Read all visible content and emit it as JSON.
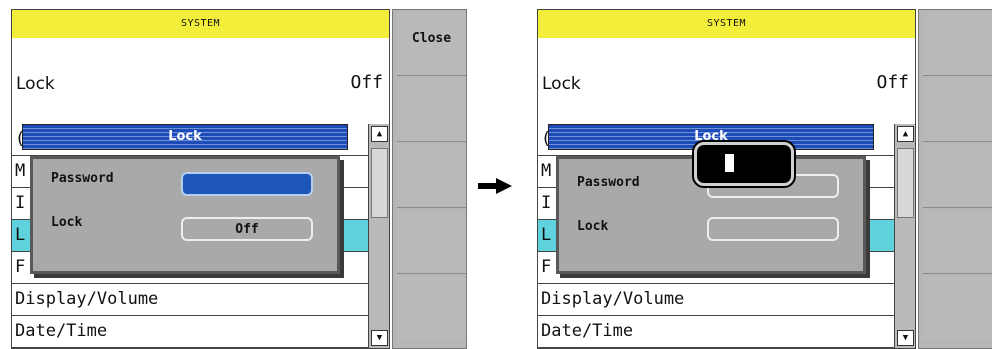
{
  "left_screen": {
    "header": "SYSTEM",
    "lock_label": "Lock",
    "lock_value": "Off",
    "list_items": [
      "(",
      "M",
      "I",
      "L",
      "F",
      "Display/Volume",
      "Date/Time"
    ],
    "side_buttons": [
      "Close",
      "",
      "",
      "",
      ""
    ],
    "dialog": {
      "title": "Lock",
      "password_label": "Password",
      "password_value": "",
      "lock_label": "Lock",
      "lock_value": "Off"
    }
  },
  "right_screen": {
    "header": "SYSTEM",
    "lock_label": "Lock",
    "lock_value": "Off",
    "list_items": [
      "(",
      "M",
      "I",
      "L",
      "F",
      "Display/Volume",
      "Date/Time"
    ],
    "side_buttons": [
      "",
      "",
      "",
      "",
      ""
    ],
    "dialog": {
      "title": "Lock",
      "password_label": "Password",
      "password_value": "",
      "lock_label": "Lock",
      "lock_value": ""
    },
    "password_entry_popup": ""
  },
  "colors": {
    "header": "#f3ee3a",
    "selected_row": "#5fd3dd",
    "dialog_title": "#1d4cb8",
    "active_field": "#1d57b8",
    "panel_gray": "#b9b9b9"
  },
  "icons": {
    "scroll_up": "triangle-up",
    "scroll_down": "triangle-down",
    "transition": "right-arrow"
  },
  "scroll_glyphs": {
    "up": "▲",
    "down": "▼"
  }
}
